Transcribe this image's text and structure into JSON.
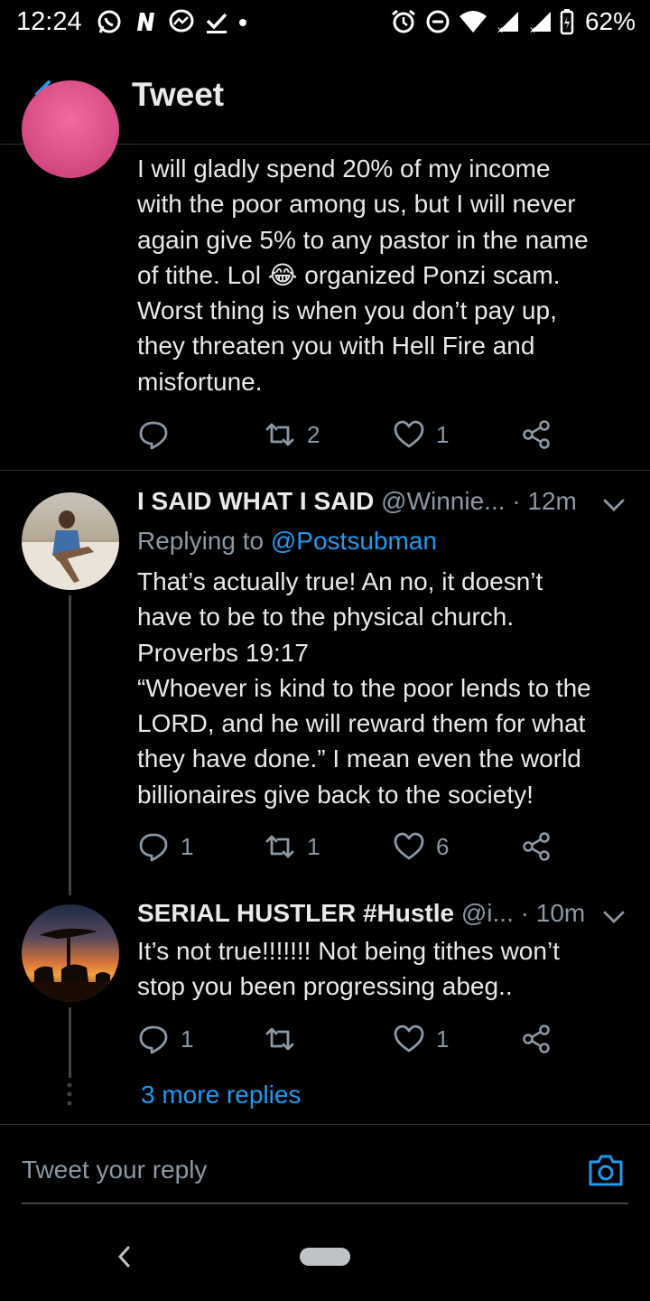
{
  "status_bar": {
    "time": "12:24",
    "battery": "62%"
  },
  "header": {
    "title": "Tweet"
  },
  "tweets": [
    {
      "text": "I will gladly spend 20% of my income\nwith the poor among us, but I will never\nagain give 5% to any pastor in the name\nof tithe. Lol 😂 organized Ponzi scam.\nWorst thing is when you don’t pay up,\nthey threaten you with Hell Fire and\nmisfortune.",
      "replies": "",
      "retweets": "2",
      "likes": "1"
    },
    {
      "name": "I SAID WHAT I SAID",
      "handle": "@Winnie...",
      "separator": "·",
      "time": "12m",
      "replying_label": "Replying to",
      "replying_to": "@Postsubman",
      "text": "That’s actually true! An no, it doesn’t\nhave to be to the physical church.\nProverbs 19:17\n“Whoever is kind to the poor lends to the\nLORD, and he will reward them for what\nthey have done.” I mean even the world\nbillionaires give back to the society!",
      "replies": "1",
      "retweets": "1",
      "likes": "6"
    },
    {
      "name": "SERIAL HUSTLER #Hustle",
      "handle": "@i...",
      "separator": "·",
      "time": "10m",
      "text": "It’s not true!!!!!!! Not being tithes won’t\nstop you been progressing abeg..",
      "replies": "1",
      "retweets": "",
      "likes": "1"
    }
  ],
  "more_replies": "3 more replies",
  "reply_input": {
    "placeholder": "Tweet your reply"
  },
  "colors": {
    "accent": "#1d9bf0",
    "muted": "#8b98a5",
    "text": "#e7e9ea",
    "background": "#000000"
  },
  "icons": [
    "whatsapp-icon",
    "n-app-icon",
    "messenger-icon",
    "download-done-icon",
    "dot-icon",
    "alarm-icon",
    "dnd-icon",
    "wifi-icon",
    "signal-icon",
    "battery-icon",
    "back-arrow-icon",
    "reply-icon",
    "retweet-icon",
    "like-icon",
    "share-icon",
    "chevron-down-icon",
    "camera-icon",
    "nav-back-icon",
    "home-pill-icon"
  ]
}
